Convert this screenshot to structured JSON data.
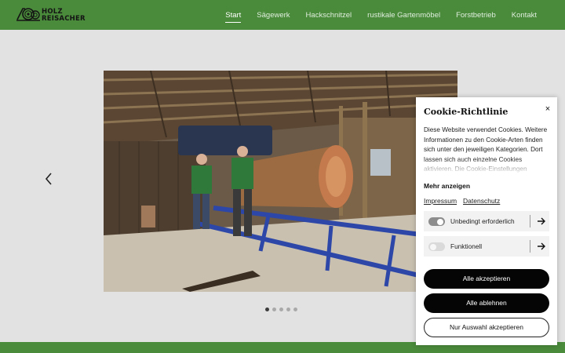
{
  "header": {
    "logo": {
      "line1": "HOLZ",
      "line2": "REISACHER",
      "icon": "log-saw-icon"
    },
    "nav": [
      {
        "label": "Start",
        "active": true
      },
      {
        "label": "Sägewerk",
        "active": false
      },
      {
        "label": "Hackschnitzel",
        "active": false
      },
      {
        "label": "rustikale Gartenmöbel",
        "active": false
      },
      {
        "label": "Forstbetrieb",
        "active": false
      },
      {
        "label": "Kontakt",
        "active": false
      }
    ]
  },
  "slider": {
    "image_subject": "two men in green shirts posing beside a large log on a sawmill carriage",
    "prev_icon": "chevron-left-icon",
    "dots": 5,
    "active_dot": 1
  },
  "cookie": {
    "title": "Cookie-Richtlinie",
    "close": "×",
    "text": "Diese Website verwendet Cookies. Weitere Informationen zu den Cookie-Arten finden sich unter den jeweiligen Kategorien. Dort lassen sich auch einzelne Cookies aktivieren. Die Cookie-Einstellungen",
    "more": "Mehr anzeigen",
    "links": [
      "Impressum",
      "Datenschutz"
    ],
    "categories": [
      {
        "label": "Unbedingt erforderlich",
        "enabled": true
      },
      {
        "label": "Funktionell",
        "enabled": false
      }
    ],
    "buttons": {
      "accept_all": "Alle akzeptieren",
      "reject_all": "Alle ablehnen",
      "accept_selection": "Nur Auswahl akzeptieren"
    }
  },
  "colors": {
    "brand_green": "#4a8a3b",
    "background": "#e2e2e2",
    "button_dark": "#050505"
  }
}
